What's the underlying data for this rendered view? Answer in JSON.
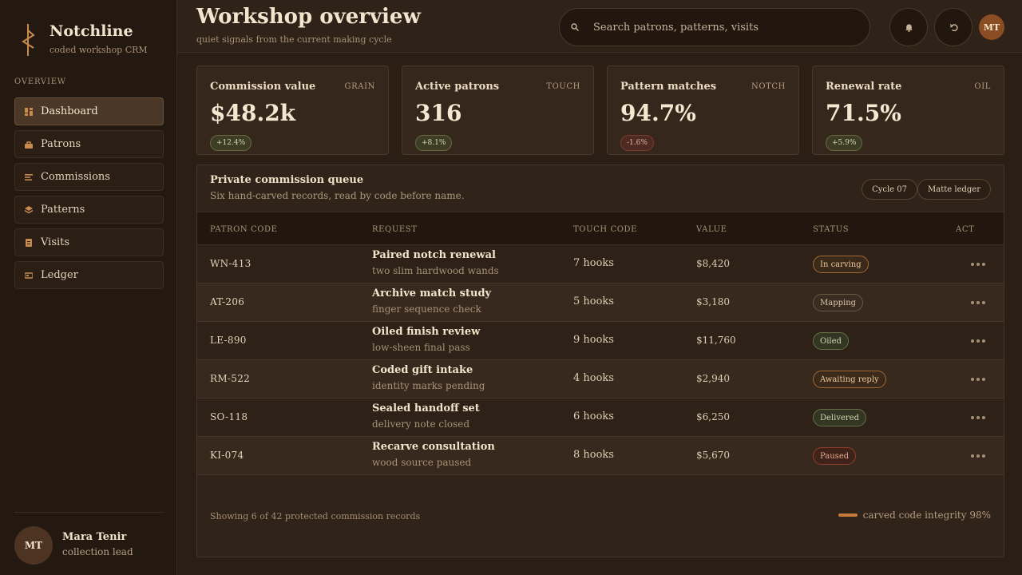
{
  "brand": {
    "name": "Notchline",
    "tagline": "coded workshop CRM"
  },
  "nav": {
    "heading": "OVERVIEW",
    "items": [
      {
        "label": "Dashboard",
        "icon": "dashboard-icon",
        "active": true
      },
      {
        "label": "Patrons",
        "icon": "patrons-icon"
      },
      {
        "label": "Commissions",
        "icon": "commissions-icon"
      },
      {
        "label": "Patterns",
        "icon": "patterns-icon"
      },
      {
        "label": "Visits",
        "icon": "visits-icon"
      },
      {
        "label": "Ledger",
        "icon": "ledger-icon"
      }
    ]
  },
  "user": {
    "initials": "MT",
    "name": "Mara Tenir",
    "role": "collection lead"
  },
  "header": {
    "title": "Workshop overview",
    "subtitle": "quiet signals from the current making cycle",
    "search_placeholder": "Search patrons, patterns, visits",
    "avatar_initials": "MT"
  },
  "kpis": [
    {
      "label": "Commission value",
      "tag": "GRAIN",
      "value": "$48.2k",
      "delta": "+12.4%",
      "trend": "up"
    },
    {
      "label": "Active patrons",
      "tag": "TOUCH",
      "value": "316",
      "delta": "+8.1%",
      "trend": "up"
    },
    {
      "label": "Pattern matches",
      "tag": "NOTCH",
      "value": "94.7%",
      "delta": "-1.6%",
      "trend": "down"
    },
    {
      "label": "Renewal rate",
      "tag": "OIL",
      "value": "71.5%",
      "delta": "+5.9%",
      "trend": "up"
    }
  ],
  "queue": {
    "title": "Private commission queue",
    "subtitle": "Six hand-carved records, read by code before name.",
    "chips": [
      "Cycle 07",
      "Matte ledger"
    ],
    "columns": [
      "PATRON CODE",
      "REQUEST",
      "TOUCH CODE",
      "VALUE",
      "STATUS",
      "ACT"
    ],
    "rows": [
      {
        "code": "WN-413",
        "request": "Paired notch renewal",
        "detail": "two slim hardwood wands",
        "touch": "7 hooks",
        "value": "$8,420",
        "status": "In carving"
      },
      {
        "code": "AT-206",
        "request": "Archive match study",
        "detail": "finger sequence check",
        "touch": "5 hooks",
        "value": "$3,180",
        "status": "Mapping"
      },
      {
        "code": "LE-890",
        "request": "Oiled finish review",
        "detail": "low-sheen final pass",
        "touch": "9 hooks",
        "value": "$11,760",
        "status": "Oiled"
      },
      {
        "code": "RM-522",
        "request": "Coded gift intake",
        "detail": "identity marks pending",
        "touch": "4 hooks",
        "value": "$2,940",
        "status": "Awaiting reply"
      },
      {
        "code": "SO-118",
        "request": "Sealed handoff set",
        "detail": "delivery note closed",
        "touch": "6 hooks",
        "value": "$6,250",
        "status": "Delivered"
      },
      {
        "code": "KI-074",
        "request": "Recarve consultation",
        "detail": "wood source paused",
        "touch": "8 hooks",
        "value": "$5,670",
        "status": "Paused"
      }
    ],
    "footer": "Showing 6 of 42 protected commission records",
    "integrity": "carved code integrity 98%"
  },
  "colors": {
    "accent": "#c47a3b",
    "background": "#2a1e15",
    "sidebar": "#241910"
  }
}
